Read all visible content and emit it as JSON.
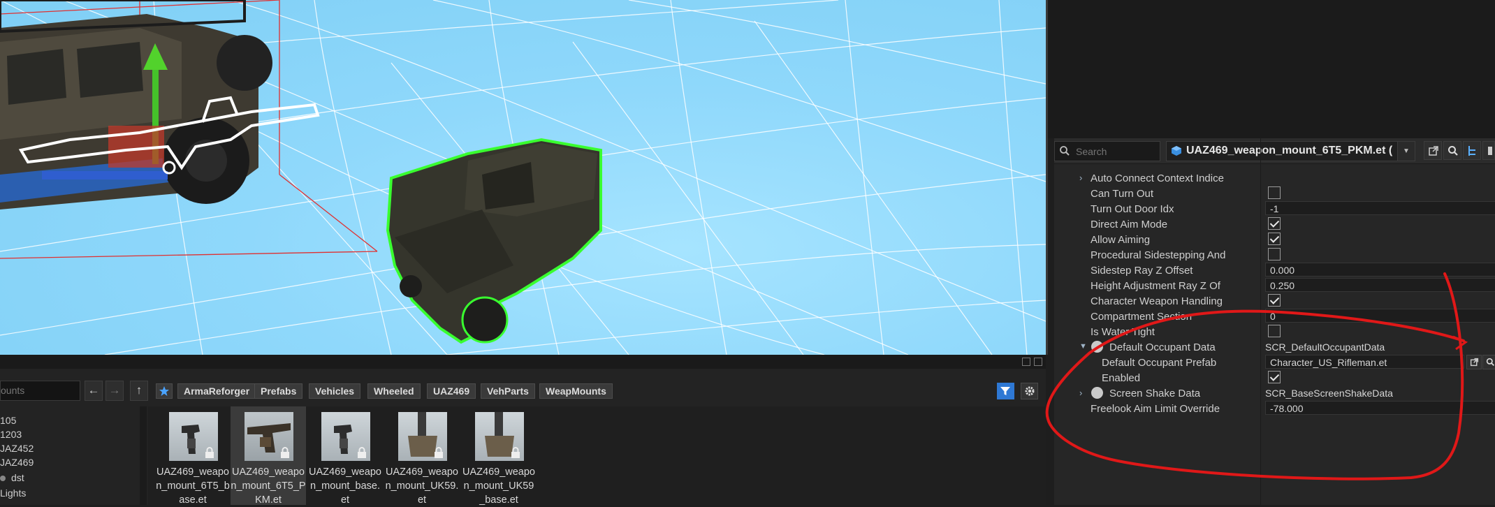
{
  "inspector": {
    "search_placeholder": "Search",
    "entity_name": "UAZ469_weapon_mount_6T5_PKM.et (",
    "rows": [
      {
        "label": "Auto Connect Context Indice",
        "type": "expander"
      },
      {
        "label": "Can Turn Out",
        "type": "checkbox",
        "checked": false
      },
      {
        "label": "Turn Out Door Idx",
        "type": "number",
        "value": "-1"
      },
      {
        "label": "Direct Aim Mode",
        "type": "checkbox",
        "checked": true
      },
      {
        "label": "Allow Aiming",
        "type": "checkbox",
        "checked": true
      },
      {
        "label": "Procedural Sidestepping And",
        "type": "checkbox",
        "checked": false
      },
      {
        "label": "Sidestep Ray Z Offset",
        "type": "field",
        "value": "0.000"
      },
      {
        "label": "Height Adjustment Ray Z Of",
        "type": "field",
        "value": "0.250"
      },
      {
        "label": "Character Weapon Handling",
        "type": "checkbox",
        "checked": true
      },
      {
        "label": "Compartment Section",
        "type": "number",
        "value": "0"
      },
      {
        "label": "Is Water Tight",
        "type": "checkbox",
        "checked": false
      },
      {
        "label": "Default Occupant Data",
        "type": "object",
        "value": "SCR_DefaultOccupantData"
      },
      {
        "label": "Default Occupant Prefab",
        "type": "prefab",
        "value": "Character_US_Rifleman.et"
      },
      {
        "label": "Enabled",
        "type": "checkbox",
        "checked": true
      },
      {
        "label": "Screen Shake Data",
        "type": "object-collapsed",
        "value": "SCR_BaseScreenShakeData"
      },
      {
        "label": "Freelook Aim Limit Override",
        "type": "field",
        "value": "-78.000"
      }
    ]
  },
  "browser": {
    "filter_text": "ounts",
    "breadcrumbs": [
      "ArmaReforger",
      "Prefabs",
      "Vehicles",
      "Wheeled",
      "UAZ469",
      "VehParts",
      "WeapMounts"
    ],
    "tree_items": [
      "105",
      "1203",
      "JAZ452",
      "JAZ469",
      "dst",
      "Lights"
    ],
    "files": [
      {
        "name": "UAZ469_weapon_mount_6T5_base.et",
        "kind": "gun",
        "selected": false
      },
      {
        "name": "UAZ469_weapon_mount_6T5_PKM.et",
        "kind": "pkm",
        "selected": true
      },
      {
        "name": "UAZ469_weapon_mount_base.et",
        "kind": "gun",
        "selected": false
      },
      {
        "name": "UAZ469_weapon_mount_UK59.et",
        "kind": "mount",
        "selected": false
      },
      {
        "name": "UAZ469_weapon_mount_UK59_base.et",
        "kind": "mount",
        "selected": false
      }
    ]
  },
  "colors": {
    "accent": "#2e78d4",
    "selection_outline": "#33ff33",
    "annotation": "#e01818"
  }
}
